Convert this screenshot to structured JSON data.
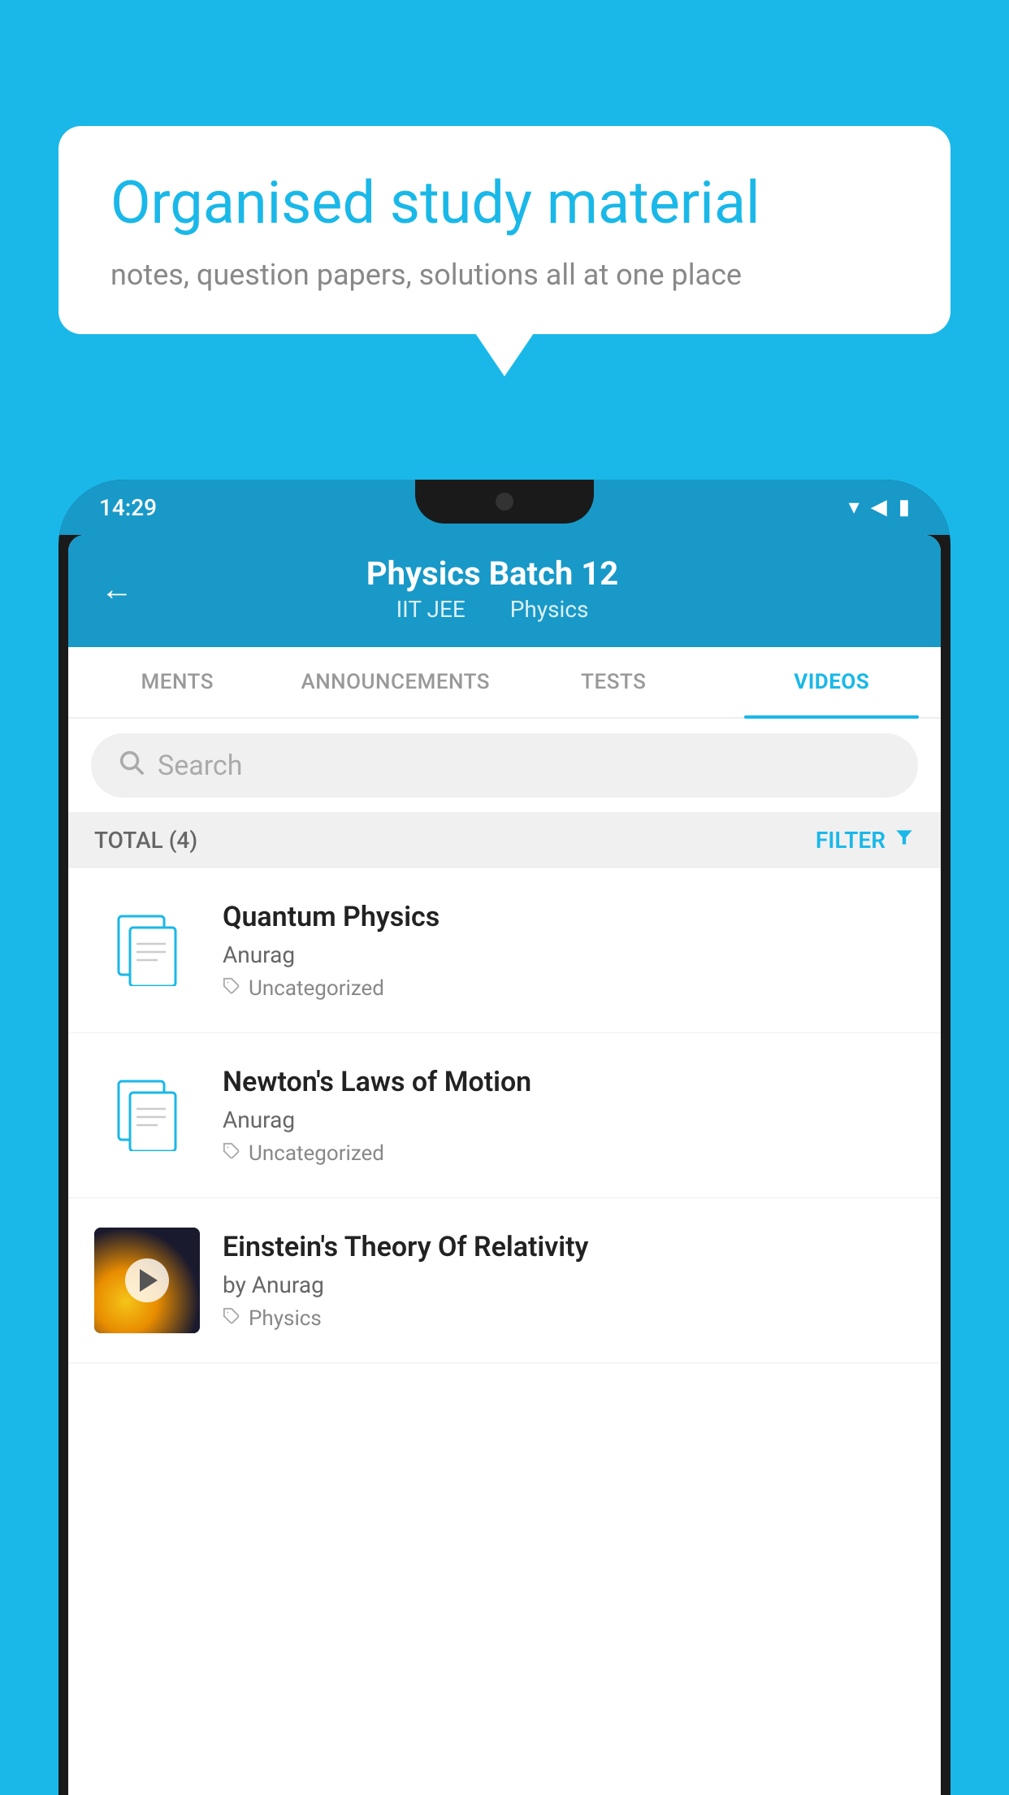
{
  "background_color": "#1ab8e8",
  "bubble": {
    "title": "Organised study material",
    "subtitle": "notes, question papers, solutions all at one place"
  },
  "phone": {
    "status_bar": {
      "time": "14:29"
    },
    "header": {
      "title": "Physics Batch 12",
      "subtitle_part1": "IIT JEE",
      "subtitle_part2": "Physics",
      "back_label": "←"
    },
    "tabs": [
      {
        "label": "MENTS",
        "active": false
      },
      {
        "label": "ANNOUNCEMENTS",
        "active": false
      },
      {
        "label": "TESTS",
        "active": false
      },
      {
        "label": "VIDEOS",
        "active": true
      }
    ],
    "search": {
      "placeholder": "Search"
    },
    "filter": {
      "total_label": "TOTAL (4)",
      "filter_label": "FILTER"
    },
    "videos": [
      {
        "id": 1,
        "title": "Quantum Physics",
        "author": "Anurag",
        "tag": "Uncategorized",
        "has_thumbnail": false
      },
      {
        "id": 2,
        "title": "Newton's Laws of Motion",
        "author": "Anurag",
        "tag": "Uncategorized",
        "has_thumbnail": false
      },
      {
        "id": 3,
        "title": "Einstein's Theory Of Relativity",
        "author": "by Anurag",
        "tag": "Physics",
        "has_thumbnail": true
      }
    ]
  }
}
